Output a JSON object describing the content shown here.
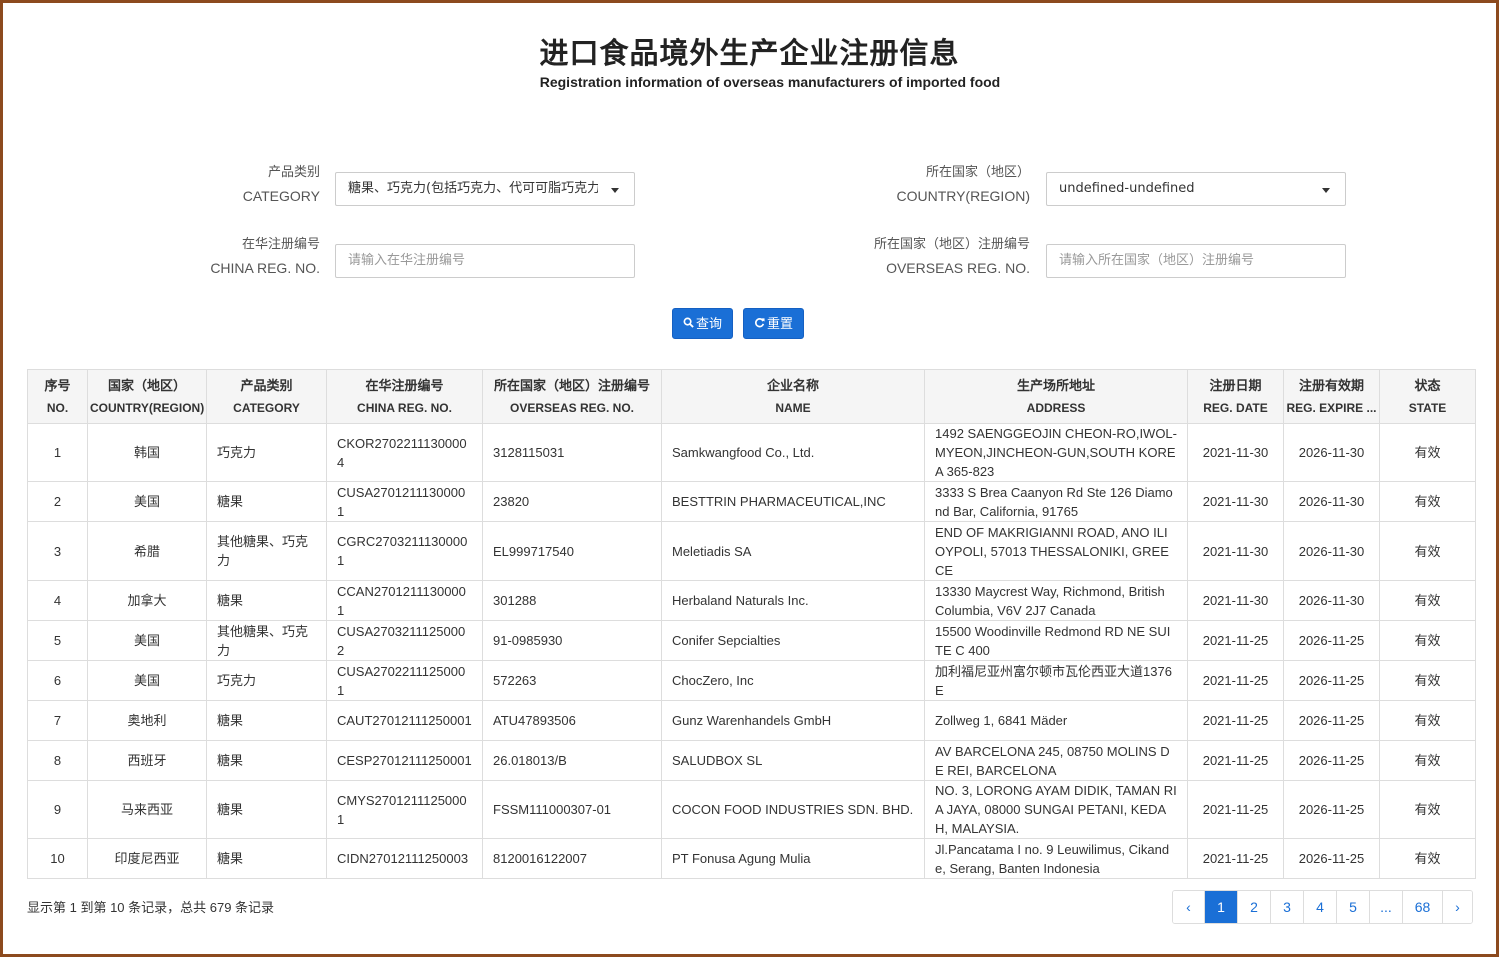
{
  "header": {
    "title": "进口食品境外生产企业注册信息",
    "subtitle": "Registration information of overseas manufacturers of imported food"
  },
  "filters": {
    "category": {
      "label_cn": "产品类别",
      "label_en": "CATEGORY",
      "value": "糖果、巧克力(包括巧克力、代可可脂巧克力及其制品)"
    },
    "country": {
      "label_cn": "所在国家（地区）",
      "label_en": "COUNTRY(REGION)",
      "value": "undefined-undefined"
    },
    "china_reg": {
      "label_cn": "在华注册编号",
      "label_en": "CHINA REG. NO.",
      "placeholder": "请输入在华注册编号"
    },
    "overseas_reg": {
      "label_cn": "所在国家（地区）注册编号",
      "label_en": "OVERSEAS REG. NO.",
      "placeholder": "请输入所在国家（地区）注册编号"
    }
  },
  "buttons": {
    "search": "查询",
    "reset": "重置"
  },
  "icons": {
    "search": "search-icon",
    "reset": "refresh-icon"
  },
  "colors": {
    "primary": "#1a6fd6",
    "frame": "#8c4a1e"
  },
  "table": {
    "headers": [
      {
        "cn": "序号",
        "en": "NO."
      },
      {
        "cn": "国家（地区）",
        "en": "COUNTRY(REGION)"
      },
      {
        "cn": "产品类别",
        "en": "CATEGORY"
      },
      {
        "cn": "在华注册编号",
        "en": "CHINA REG. NO."
      },
      {
        "cn": "所在国家（地区）注册编号",
        "en": "OVERSEAS REG. NO."
      },
      {
        "cn": "企业名称",
        "en": "NAME"
      },
      {
        "cn": "生产场所地址",
        "en": "ADDRESS"
      },
      {
        "cn": "注册日期",
        "en": "REG. DATE"
      },
      {
        "cn": "注册有效期",
        "en": "REG. EXPIRE ..."
      },
      {
        "cn": "状态",
        "en": "STATE"
      }
    ],
    "rows": [
      {
        "no": "1",
        "country": "韩国",
        "category": "巧克力",
        "china_reg": "CKOR27022111300004",
        "overseas_reg": "3128115031",
        "name": "Samkwangfood Co., Ltd.",
        "address": "1492 SAENGGEOJIN CHEON-RO,IWOL-MYEON,JINCHEON-GUN,SOUTH KOREA 365-823",
        "reg_date": "2021-11-30",
        "expire": "2026-11-30",
        "state": "有效"
      },
      {
        "no": "2",
        "country": "美国",
        "category": "糖果",
        "china_reg": "CUSA27012111300001",
        "overseas_reg": "23820",
        "name": "BESTTRIN PHARMACEUTICAL,INC",
        "address": "3333 S Brea Caanyon Rd Ste 126 Diamond Bar, California, 91765",
        "reg_date": "2021-11-30",
        "expire": "2026-11-30",
        "state": "有效"
      },
      {
        "no": "3",
        "country": "希腊",
        "category": "其他糖果、巧克力",
        "china_reg": "CGRC27032111300001",
        "overseas_reg": "EL999717540",
        "name": "Meletiadis SA",
        "address": "END OF MAKRIGIANNI ROAD, ANO ILIOYPOLI, 57013 THESSALONIKI, GREECE",
        "reg_date": "2021-11-30",
        "expire": "2026-11-30",
        "state": "有效"
      },
      {
        "no": "4",
        "country": "加拿大",
        "category": "糖果",
        "china_reg": "CCAN27012111300001",
        "overseas_reg": "301288",
        "name": "Herbaland Naturals Inc.",
        "address": "13330 Maycrest Way, Richmond, British Columbia, V6V 2J7 Canada",
        "reg_date": "2021-11-30",
        "expire": "2026-11-30",
        "state": "有效"
      },
      {
        "no": "5",
        "country": "美国",
        "category": "其他糖果、巧克力",
        "china_reg": "CUSA27032111250002",
        "overseas_reg": "91-0985930",
        "name": "Conifer Sepcialties",
        "address": "15500 Woodinville Redmond RD NE SUITE C 400",
        "reg_date": "2021-11-25",
        "expire": "2026-11-25",
        "state": "有效"
      },
      {
        "no": "6",
        "country": "美国",
        "category": "巧克力",
        "china_reg": "CUSA27022111250001",
        "overseas_reg": "572263",
        "name": "ChocZero, Inc",
        "address": "加利福尼亚州富尔顿市瓦伦西亚大道1376E",
        "reg_date": "2021-11-25",
        "expire": "2026-11-25",
        "state": "有效"
      },
      {
        "no": "7",
        "country": "奥地利",
        "category": "糖果",
        "china_reg": "CAUT27012111250001",
        "overseas_reg": "ATU47893506",
        "name": "Gunz Warenhandels GmbH",
        "address": "Zollweg 1, 6841 Mäder",
        "reg_date": "2021-11-25",
        "expire": "2026-11-25",
        "state": "有效"
      },
      {
        "no": "8",
        "country": "西班牙",
        "category": "糖果",
        "china_reg": "CESP27012111250001",
        "overseas_reg": "26.018013/B",
        "name": "SALUDBOX SL",
        "address": "AV BARCELONA 245, 08750 MOLINS DE REI, BARCELONA",
        "reg_date": "2021-11-25",
        "expire": "2026-11-25",
        "state": "有效"
      },
      {
        "no": "9",
        "country": "马来西亚",
        "category": "糖果",
        "china_reg": "CMYS27012111250001",
        "overseas_reg": "FSSM111000307-01",
        "name": "COCON FOOD INDUSTRIES SDN. BHD.",
        "address": "NO. 3, LORONG AYAM DIDIK, TAMAN RIA JAYA, 08000 SUNGAI PETANI, KEDAH, MALAYSIA.",
        "reg_date": "2021-11-25",
        "expire": "2026-11-25",
        "state": "有效"
      },
      {
        "no": "10",
        "country": "印度尼西亚",
        "category": "糖果",
        "china_reg": "CIDN27012111250003",
        "overseas_reg": "8120016122007",
        "name": "PT Fonusa Agung Mulia",
        "address": "Jl.Pancatama I no. 9 Leuwilimus, Cikande, Serang, Banten Indonesia",
        "reg_date": "2021-11-25",
        "expire": "2026-11-25",
        "state": "有效"
      }
    ]
  },
  "footer": {
    "summary": "显示第 1 到第 10 条记录，总共 679 条记录",
    "pagination": {
      "prev": "‹",
      "pages": [
        "1",
        "2",
        "3",
        "4",
        "5",
        "...",
        "68"
      ],
      "active": "1",
      "next": "›"
    }
  }
}
